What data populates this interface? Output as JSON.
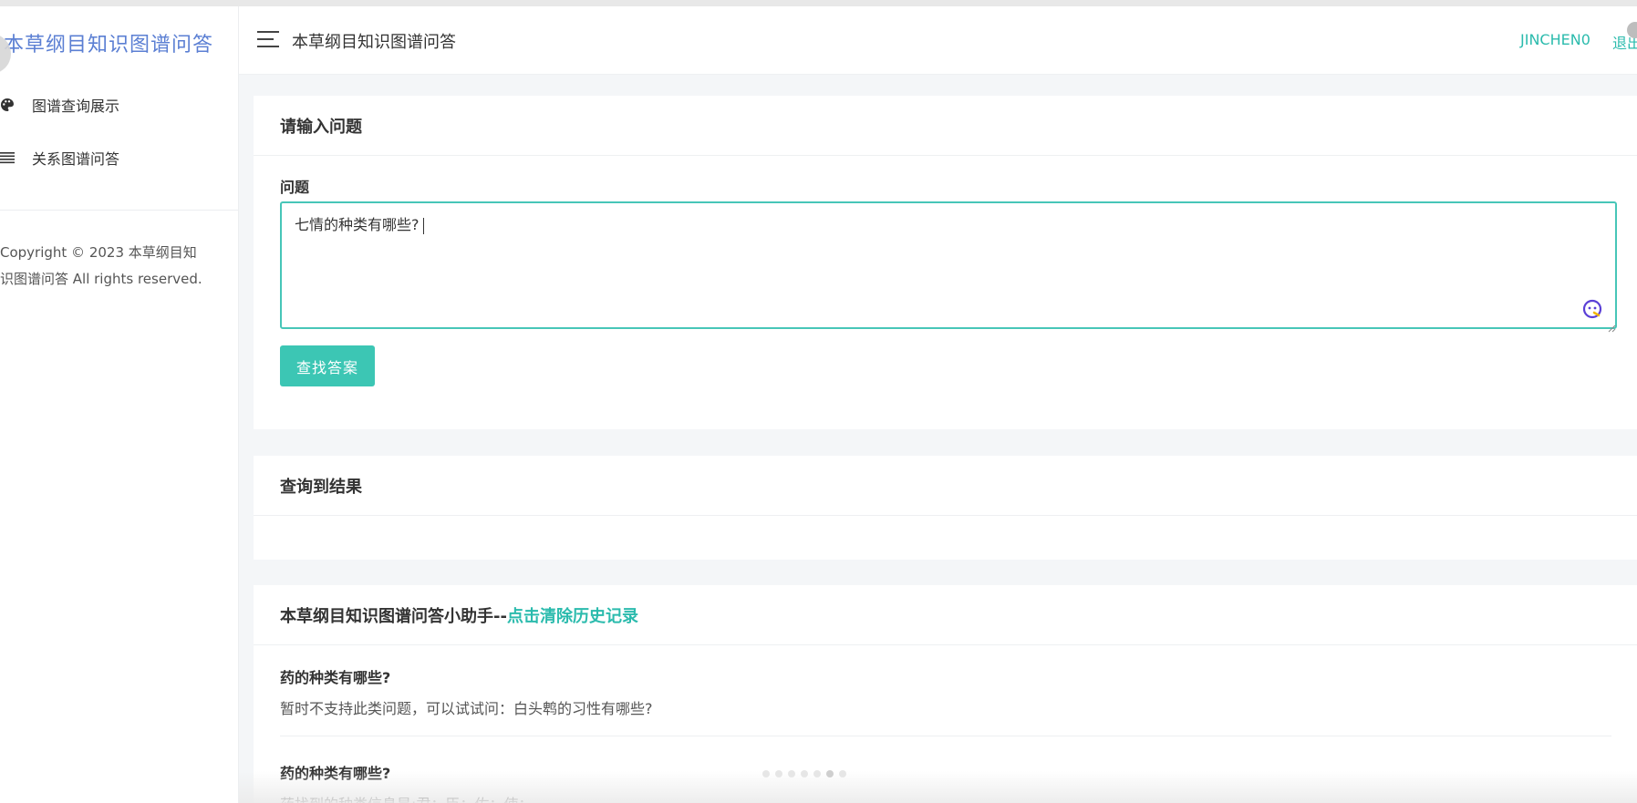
{
  "sidebar": {
    "brand": "本草纲目知识图谱问答",
    "items": [
      {
        "label": "图谱查询展示",
        "icon": "palette-icon"
      },
      {
        "label": "关系图谱问答",
        "icon": "list-icon"
      }
    ],
    "copyright_line1": "Copyright © 2023 本草纲目知",
    "copyright_line2": "识图谱问答 All rights reserved."
  },
  "header": {
    "title": "本草纲目知识图谱问答",
    "username": "JINCHEN0",
    "logout_label": "退出"
  },
  "question_card": {
    "title": "请输入问题",
    "field_label": "问题",
    "input_value": "七情的种类有哪些?",
    "search_button": "查找答案"
  },
  "result_card": {
    "title": "查询到结果"
  },
  "assistant_card": {
    "title_prefix": "本草纲目知识图谱问答小助手--",
    "clear_history_label": "点击清除历史记录",
    "history": [
      {
        "question": "药的种类有哪些?",
        "answer": "暂时不支持此类问题，可以试试问：白头鹎的习性有哪些?"
      },
      {
        "question": "药的种类有哪些?",
        "answer": "药找到的种类信息是:君；臣；佐；使；"
      }
    ]
  },
  "colors": {
    "accent": "#2bbbad",
    "button": "#3cc6b4",
    "brand": "#5b7fd3",
    "input_border": "#47c6b8"
  }
}
